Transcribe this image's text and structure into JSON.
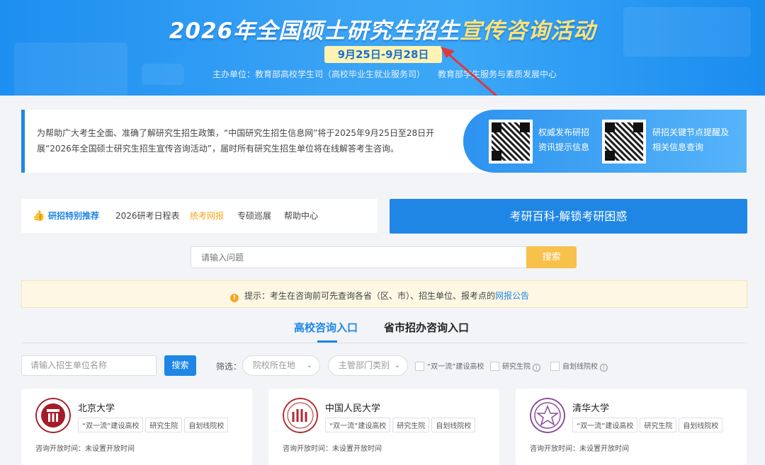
{
  "banner": {
    "title_main": "2026年全国硕士研究生招生",
    "title_highlight": "宣传咨询活动",
    "date_range": "9月25日-9月28日",
    "organizer_1": "主办单位：教育部高校学生司（高校毕业生就业服务司）",
    "organizer_2": "教育部学生服务与素质发展中心"
  },
  "intro": {
    "text": "为帮助广大考生全面、准确了解研究生招生政策，“中国研究生招生信息网”将于2025年9月25日至28日开展“2026年全国硕士研究生招生宣传咨询活动”，届时所有研究生招生单位将在线解答考生咨询。",
    "qr1_label": "权威发布研招资讯提示信息",
    "qr2_label": "研招关键节点提醒及相关信息查询"
  },
  "nav": {
    "special_label": "研招特别推荐",
    "items": [
      "2026研考日程表",
      "统考网报",
      "专硕巡展",
      "帮助中心"
    ],
    "active_item": "统考网报",
    "big_button": "考研百科-解锁考研困惑"
  },
  "question_search": {
    "placeholder": "请输入问题",
    "button": "搜索"
  },
  "notice": {
    "text": "提示：考生在咨询前可先查询各省（区、市）、招生单位、报考点的",
    "link": "网报公告"
  },
  "tabs": {
    "active": "高校咨询入口",
    "other": "省市招办咨询入口"
  },
  "filters": {
    "unit_placeholder": "请输入招生单位名称",
    "search_button": "搜索",
    "label": "筛选：",
    "location_select": "院校所在地",
    "department_select": "主管部门类别",
    "check_1": "“双一流”建设高校",
    "check_2": "研究生院",
    "check_3": "自划线院校"
  },
  "universities": [
    {
      "name": "北京大学",
      "tags": [
        "“双一流”建设高校",
        "研究生院",
        "自划线院校"
      ],
      "time": "咨询开放时间：未设置开放时间"
    },
    {
      "name": "中国人民大学",
      "tags": [
        "“双一流”建设高校",
        "研究生院",
        "自划线院校"
      ],
      "time": "咨询开放时间：未设置开放时间"
    },
    {
      "name": "清华大学",
      "tags": [
        "“双一流”建设高校",
        "研究生院",
        "自划线院校"
      ],
      "time": "咨询开放时间：未设置开放时间"
    }
  ],
  "colors": {
    "primary": "#1f86e6",
    "accent_yellow": "#f8c14c",
    "pku_red": "#a61b29",
    "ruc_red": "#b3262d",
    "thu_purple": "#8a4c9a"
  },
  "icons": [
    "thumbs-up-icon",
    "warning-icon",
    "chevron-down-icon",
    "info-icon",
    "qr-code-icon"
  ]
}
